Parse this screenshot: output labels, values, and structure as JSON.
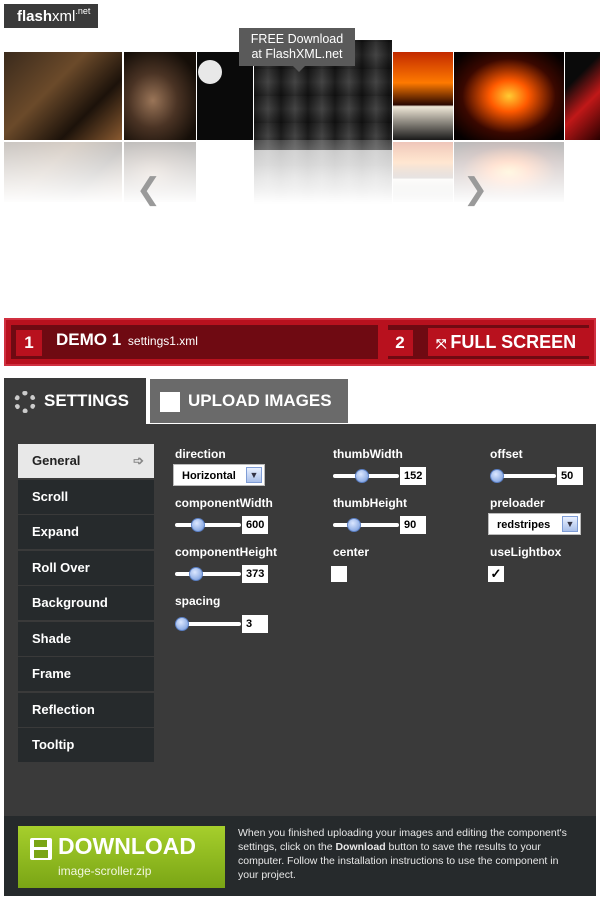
{
  "logo": {
    "main": "flash",
    "rest": "xml",
    "tld": ".net"
  },
  "tooltip": {
    "line1": "FREE Download",
    "line2": "at FlashXML.net"
  },
  "demo": {
    "num1": "1",
    "title": "DEMO 1",
    "subtitle": "settings1.xml",
    "num2": "2",
    "fullscreen": "FULL SCREEN"
  },
  "tabs": {
    "settings": "SETTINGS",
    "upload": "UPLOAD IMAGES"
  },
  "menu": [
    "General",
    "Scroll",
    "Expand",
    "Roll Over",
    "Background",
    "Shade",
    "Frame",
    "Reflection",
    "Tooltip"
  ],
  "menu_active": "General",
  "settings": {
    "direction": {
      "label": "direction",
      "value": "Horizontal"
    },
    "componentWidth": {
      "label": "componentWidth",
      "value": "600"
    },
    "componentHeight": {
      "label": "componentHeight",
      "value": "373"
    },
    "spacing": {
      "label": "spacing",
      "value": "3"
    },
    "thumbWidth": {
      "label": "thumbWidth",
      "value": "152"
    },
    "thumbHeight": {
      "label": "thumbHeight",
      "value": "90"
    },
    "center": {
      "label": "center",
      "checked": false
    },
    "offset": {
      "label": "offset",
      "value": "50"
    },
    "preloader": {
      "label": "preloader",
      "value": "redstripes"
    },
    "useLightbox": {
      "label": "useLightbox",
      "checked": true
    }
  },
  "download": {
    "label": "DOWNLOAD",
    "file": "image-scroller.zip",
    "desc_a": "When you finished uploading your images and editing the component's settings, click on the ",
    "desc_b": "Download",
    "desc_c": " button to save the results to your computer. Follow the installation instructions to use the component in your project."
  },
  "colors": {
    "accent_red": "#b8111e",
    "dark_red": "#6f0a12",
    "panel": "#3a3a3a",
    "green": "#8ab81e"
  },
  "icons": {
    "prev": "chevron-left-icon",
    "next": "chevron-right-icon",
    "settings": "gear-icon",
    "upload": "image-grid-icon",
    "fullscreen": "expand-icon",
    "download": "floppy-disk-icon"
  }
}
